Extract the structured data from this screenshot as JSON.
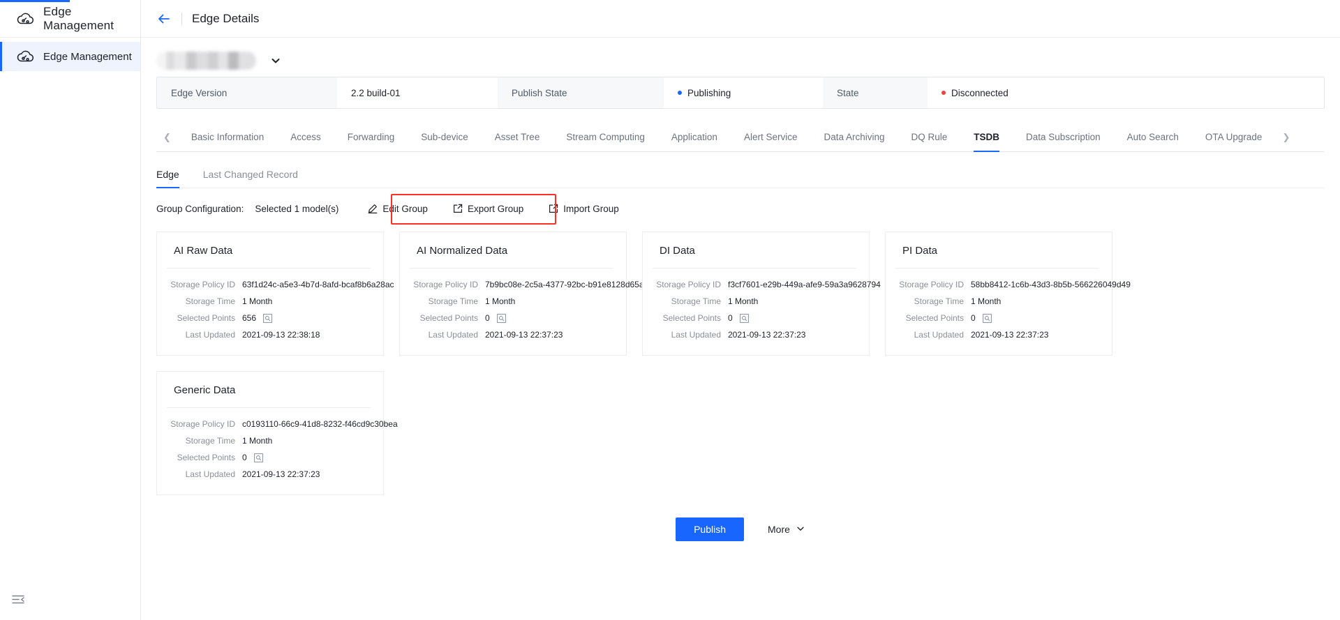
{
  "sidebar": {
    "brand": "Edge Management",
    "brand_icon": "cloud-edge-icon",
    "items": [
      {
        "label": "Edge Management",
        "icon": "cloud-edge-icon",
        "active": true
      }
    ],
    "collapse_icon": "collapse-menu-icon"
  },
  "header": {
    "back_icon": "arrow-left-icon",
    "title": "Edge Details"
  },
  "device_selector": {
    "value": "",
    "redacted": true,
    "chevron_icon": "chevron-down-icon"
  },
  "info_strip": [
    {
      "label": "Edge Version",
      "value": "2.2 build-01",
      "dot": ""
    },
    {
      "label": "Publish State",
      "value": "Publishing",
      "dot": "#1966ff"
    },
    {
      "label": "State",
      "value": "Disconnected",
      "dot": "#f53f3f"
    }
  ],
  "tabs": {
    "prev_icon": "chevron-left-icon",
    "next_icon": "chevron-right-icon",
    "items": [
      "Basic Information",
      "Access",
      "Forwarding",
      "Sub-device",
      "Asset Tree",
      "Stream Computing",
      "Application",
      "Alert Service",
      "Data Archiving",
      "DQ Rule",
      "TSDB",
      "Data Subscription",
      "Auto Search",
      "OTA Upgrade"
    ],
    "active": "TSDB"
  },
  "subtabs": {
    "items": [
      "Edge",
      "Last Changed Record"
    ],
    "active": "Edge"
  },
  "group_bar": {
    "label": "Group Configuration:",
    "selected_text": "Selected 1 model(s)",
    "actions": [
      {
        "label": "Edit  Group",
        "icon": "pencil-icon",
        "boxed": false
      },
      {
        "label": "Export  Group",
        "icon": "export-icon",
        "boxed": true
      },
      {
        "label": "Import  Group",
        "icon": "import-icon",
        "boxed": true
      }
    ],
    "highlight_color": "#fe2f27"
  },
  "card_labels": {
    "storage_policy_id": "Storage Policy ID",
    "storage_time": "Storage Time",
    "selected_points": "Selected Points",
    "last_updated": "Last Updated",
    "search_icon": "search-points-icon"
  },
  "cards": [
    {
      "title": "AI Raw Data",
      "storage_policy_id": "63f1d24c-a5e3-4b7d-8afd-bcaf8b6a28ac",
      "storage_time": "1 Month",
      "selected_points": "656",
      "last_updated": "2021-09-13 22:38:18"
    },
    {
      "title": "AI Normalized Data",
      "storage_policy_id": "7b9bc08e-2c5a-4377-92bc-b91e8128d65a",
      "storage_time": "1 Month",
      "selected_points": "0",
      "last_updated": "2021-09-13 22:37:23"
    },
    {
      "title": "DI Data",
      "storage_policy_id": "f3cf7601-e29b-449a-afe9-59a3a9628794",
      "storage_time": "1 Month",
      "selected_points": "0",
      "last_updated": "2021-09-13 22:37:23"
    },
    {
      "title": "PI Data",
      "storage_policy_id": "58bb8412-1c6b-43d3-8b5b-566226049d49",
      "storage_time": "1 Month",
      "selected_points": "0",
      "last_updated": "2021-09-13 22:37:23"
    },
    {
      "title": "Generic Data",
      "storage_policy_id": "c0193110-66c9-41d8-8232-f46cd9c30bea",
      "storage_time": "1 Month",
      "selected_points": "0",
      "last_updated": "2021-09-13 22:37:23"
    }
  ],
  "footer": {
    "publish_label": "Publish",
    "more_label": "More",
    "more_icon": "chevron-down-icon",
    "primary_color": "#1966ff"
  }
}
